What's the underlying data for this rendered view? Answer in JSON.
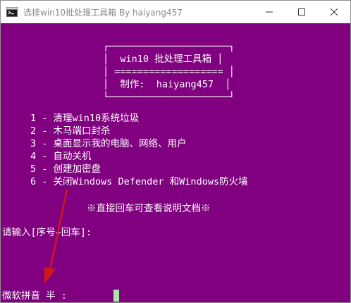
{
  "window": {
    "title": "选择win10批处理工具箱  By haiyang457",
    "controls": {
      "minimize": "—",
      "maximize": "☐",
      "close": "✕"
    }
  },
  "console": {
    "box": {
      "top_border": "┌─────────────────────┐",
      "row1": "│  win10 批处理工具箱 │",
      "row2": "│ =================== │",
      "row3": "│  制作:  haiyang457  │",
      "bottom_border": "└─────────────────────┘"
    },
    "menu": [
      "1 - 清理win10系统垃圾",
      "2 - 木马端口封杀",
      "3 - 桌面显示我的电脑、网络、用户",
      "4 - 自动关机",
      "5 - 创建加密盘",
      "6 - 关闭Windows Defender 和Windows防火墙"
    ],
    "hint": "※直接回车可查看说明文档※",
    "prompt": "请输入[序号+回车]:",
    "ime_status": "微软拼音 半 :"
  },
  "colors": {
    "console_bg": "#800080",
    "console_fg": "#ffffff",
    "cursor": "#a8e6a8",
    "annotation_arrow": "#d01818"
  }
}
